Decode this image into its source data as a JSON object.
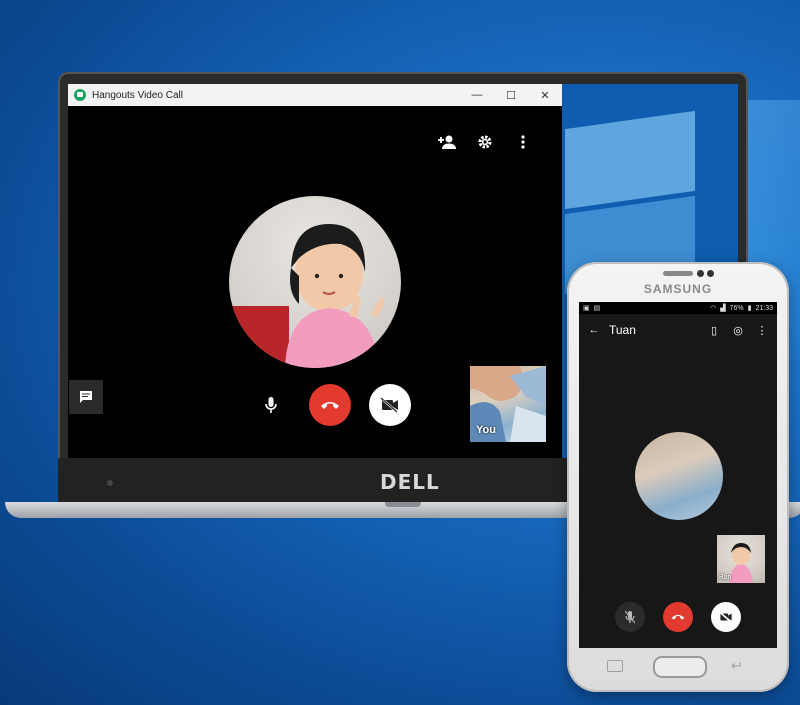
{
  "window": {
    "title": "Hangouts Video Call",
    "minimize": "—",
    "maximize": "☐",
    "close": "✕"
  },
  "laptop": {
    "brand": "DELL"
  },
  "call": {
    "self_label": "You"
  },
  "phone": {
    "brand": "SAMSUNG",
    "status": {
      "battery": "76%",
      "time": "21:33"
    },
    "contact_name": "Tuan",
    "thumb_label": "Bạn"
  },
  "colors": {
    "hangup": "#e23a2f",
    "hangouts_green": "#1aa260"
  }
}
